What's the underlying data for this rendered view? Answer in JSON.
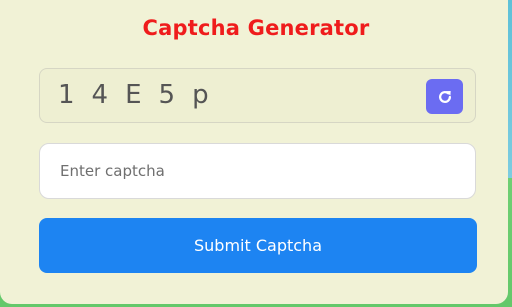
{
  "title": "Captcha Generator",
  "captcha": {
    "characters": [
      "1",
      "4",
      "E",
      "5",
      "p"
    ]
  },
  "refresh": {
    "icon": "refresh-icon"
  },
  "input": {
    "placeholder": "Enter captcha",
    "value": ""
  },
  "submit": {
    "label": "Submit Captcha"
  },
  "colors": {
    "title": "#ef1c1c",
    "card_background": "#f1f2d6",
    "refresh_button": "#6b6cf2",
    "submit_button": "#1d84f2"
  }
}
